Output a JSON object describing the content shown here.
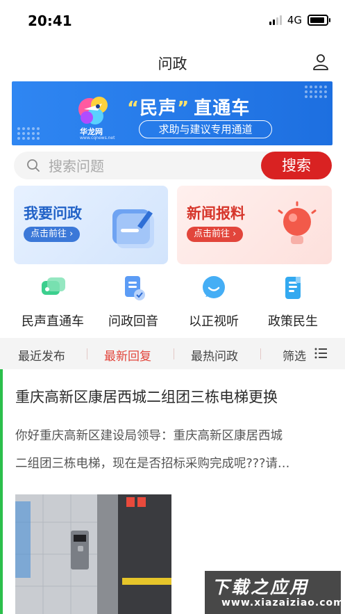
{
  "status_bar": {
    "time": "20:41",
    "network": "4G"
  },
  "header": {
    "title": "问政"
  },
  "banner": {
    "title_quote_open": "“",
    "title_highlight": "民声",
    "title_quote_close": "”",
    "title_rest": "直通车",
    "subtitle": "求助与建议专用通道",
    "logo_label": "华龙网",
    "logo_sub": "www.cqnews.net"
  },
  "search": {
    "placeholder": "搜索问题",
    "button_label": "搜索"
  },
  "cards": [
    {
      "title": "我要问政",
      "action": "点击前往 ›",
      "color": "#2162c7"
    },
    {
      "title": "新闻报料",
      "action": "点击前往 ›",
      "color": "#d6352a"
    }
  ],
  "quick_links": [
    {
      "label": "民声直通车",
      "icon": "chat-bubbles-icon"
    },
    {
      "label": "问政回音",
      "icon": "document-check-icon"
    },
    {
      "label": "以正视听",
      "icon": "smile-bubble-icon"
    },
    {
      "label": "政策民生",
      "icon": "policy-document-icon"
    }
  ],
  "tabs": [
    {
      "label": "最近发布",
      "active": false
    },
    {
      "label": "最新回复",
      "active": true
    },
    {
      "label": "最热问政",
      "active": false
    }
  ],
  "filter_label": "筛选",
  "article": {
    "title": "重庆高新区康居西城二组团三栋电梯更换",
    "excerpt_line1": "你好重庆高新区建设局领导：重庆高新区康居西城",
    "excerpt_line2": "二组团三栋电梯，现在是否招标采购完成呢???请…"
  },
  "watermark": {
    "main": "下载之应用",
    "sub": "www.xiazaiziao.com"
  },
  "colors": {
    "accent_red": "#d92222",
    "tab_active": "#e2453b",
    "accent_green": "#2bbf4b",
    "banner_blue": "#2f86f2"
  }
}
